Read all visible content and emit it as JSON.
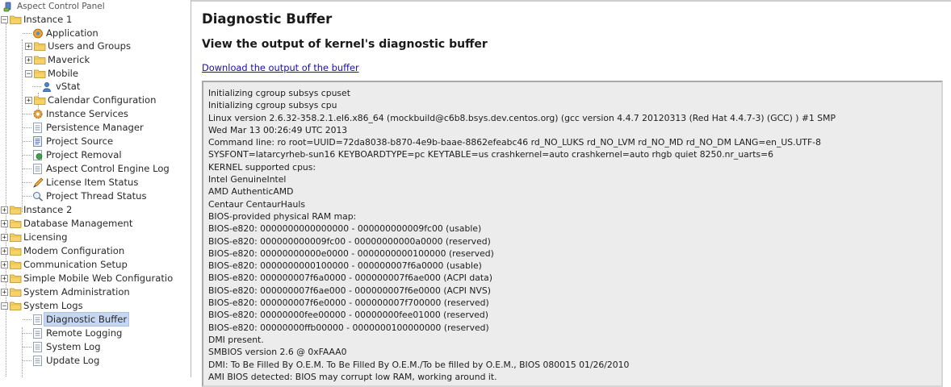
{
  "sidebar": {
    "root_label": "Aspect Control Panel",
    "items": [
      {
        "label": "Instance 1",
        "type": "folder",
        "toggle": "−"
      },
      {
        "label": "Application",
        "type": "app"
      },
      {
        "label": "Users and Groups",
        "type": "folder",
        "toggle": "+"
      },
      {
        "label": "Maverick",
        "type": "folder",
        "toggle": "+"
      },
      {
        "label": "Mobile",
        "type": "folder",
        "toggle": "−"
      },
      {
        "label": "vStat",
        "type": "user"
      },
      {
        "label": "Calendar Configuration",
        "type": "folder",
        "toggle": "+"
      },
      {
        "label": "Instance Services",
        "type": "gear"
      },
      {
        "label": "Persistence Manager",
        "type": "page"
      },
      {
        "label": "Project Source",
        "type": "doc"
      },
      {
        "label": "Project Removal",
        "type": "removal"
      },
      {
        "label": "Aspect Control Engine Log",
        "type": "page"
      },
      {
        "label": "License Item Status",
        "type": "pen"
      },
      {
        "label": "Project Thread Status",
        "type": "search"
      },
      {
        "label": "Instance 2",
        "type": "folder",
        "toggle": "+"
      },
      {
        "label": "Database Management",
        "type": "folder",
        "toggle": "+"
      },
      {
        "label": "Licensing",
        "type": "folder",
        "toggle": "+"
      },
      {
        "label": "Modem Configuration",
        "type": "folder",
        "toggle": "+"
      },
      {
        "label": "Communication Setup",
        "type": "folder",
        "toggle": "+"
      },
      {
        "label": "Simple Mobile Web Configuratio",
        "type": "folder",
        "toggle": "+"
      },
      {
        "label": "System Administration",
        "type": "folder",
        "toggle": "+"
      },
      {
        "label": "System Logs",
        "type": "folder",
        "toggle": "−"
      },
      {
        "label": "Diagnostic Buffer",
        "type": "page"
      },
      {
        "label": "Remote Logging",
        "type": "page"
      },
      {
        "label": "System Log",
        "type": "page"
      },
      {
        "label": "Update Log",
        "type": "page"
      }
    ]
  },
  "main": {
    "title": "Diagnostic Buffer",
    "subtitle": "View the output of kernel's diagnostic buffer",
    "download_link": "Download the output of the buffer",
    "buffer_lines": [
      "Initializing cgroup subsys cpuset",
      "Initializing cgroup subsys cpu",
      "Linux version 2.6.32-358.2.1.el6.x86_64 (mockbuild@c6b8.bsys.dev.centos.org) (gcc version 4.4.7 20120313 (Red Hat 4.4.7-3) (GCC) ) #1 SMP",
      "Wed Mar 13 00:26:49 UTC 2013",
      "Command line: ro root=UUID=72da8038-b870-4e9b-baae-8862efeabc46 rd_NO_LUKS rd_NO_LVM rd_NO_MD rd_NO_DM LANG=en_US.UTF-8",
      "SYSFONT=latarcyrheb-sun16 KEYBOARDTYPE=pc KEYTABLE=us crashkernel=auto crashkernel=auto rhgb quiet 8250.nr_uarts=6",
      "KERNEL supported cpus:",
      "Intel GenuineIntel",
      "AMD AuthenticAMD",
      "Centaur CentaurHauls",
      "BIOS-provided physical RAM map:",
      "BIOS-e820: 0000000000000000 - 000000000009fc00 (usable)",
      "BIOS-e820: 000000000009fc00 - 00000000000a0000 (reserved)",
      "BIOS-e820: 00000000000e0000 - 0000000000100000 (reserved)",
      "BIOS-e820: 0000000000100000 - 000000007f6a0000 (usable)",
      "BIOS-e820: 000000007f6a0000 - 000000007f6ae000 (ACPI data)",
      "BIOS-e820: 000000007f6ae000 - 000000007f6e0000 (ACPI NVS)",
      "BIOS-e820: 000000007f6e0000 - 000000007f700000 (reserved)",
      "BIOS-e820: 00000000fee00000 - 00000000fee01000 (reserved)",
      "BIOS-e820: 00000000ffb00000 - 0000000100000000 (reserved)",
      "DMI present.",
      "SMBIOS version 2.6 @ 0xFAAA0",
      "DMI: To Be Filled By O.E.M. To Be Filled By O.E.M./To be filled by O.E.M., BIOS 080015 01/26/2010",
      "AMI BIOS detected: BIOS may corrupt low RAM, working around it."
    ]
  },
  "colors": {
    "selected_bg": "#c6d8f1",
    "link": "#1a0dab",
    "folder": "#f2c94c",
    "buffer_bg": "#ececec"
  }
}
